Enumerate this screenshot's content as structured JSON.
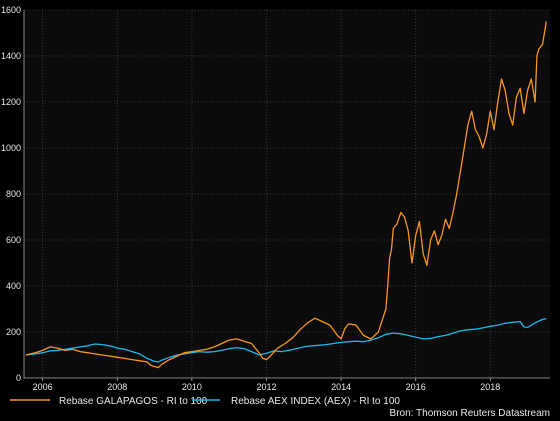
{
  "chart_data": {
    "type": "line",
    "title": "",
    "xlabel": "",
    "ylabel": "",
    "xlim": [
      2005.5,
      2019.6
    ],
    "ylim": [
      0,
      1600
    ],
    "x_ticks": [
      {
        "value": 2006,
        "label": "2006"
      },
      {
        "value": 2008,
        "label": "2008"
      },
      {
        "value": 2010,
        "label": "2010"
      },
      {
        "value": 2012,
        "label": "2012"
      },
      {
        "value": 2014,
        "label": "2014"
      },
      {
        "value": 2016,
        "label": "2016"
      },
      {
        "value": 2018,
        "label": "2018"
      }
    ],
    "y_ticks": [
      {
        "value": 0,
        "label": "0"
      },
      {
        "value": 200,
        "label": "200"
      },
      {
        "value": 400,
        "label": "400"
      },
      {
        "value": 600,
        "label": "600"
      },
      {
        "value": 800,
        "label": "800"
      },
      {
        "value": 1000,
        "label": "1000"
      },
      {
        "value": 1200,
        "label": "1200"
      },
      {
        "value": 1400,
        "label": "1400"
      },
      {
        "value": 1600,
        "label": "1600"
      }
    ],
    "grid": true,
    "legend_position": "bottom",
    "series": [
      {
        "name": "Rebase GALAPAGOS - RI to 100",
        "color": "#f7941d",
        "points": [
          [
            2005.55,
            100
          ],
          [
            2005.8,
            110
          ],
          [
            2006.0,
            120
          ],
          [
            2006.2,
            135
          ],
          [
            2006.4,
            130
          ],
          [
            2006.6,
            120
          ],
          [
            2006.8,
            125
          ],
          [
            2007.0,
            115
          ],
          [
            2007.2,
            110
          ],
          [
            2007.4,
            105
          ],
          [
            2007.6,
            100
          ],
          [
            2007.8,
            95
          ],
          [
            2008.0,
            90
          ],
          [
            2008.2,
            85
          ],
          [
            2008.4,
            80
          ],
          [
            2008.6,
            75
          ],
          [
            2008.8,
            70
          ],
          [
            2008.9,
            55
          ],
          [
            2009.0,
            50
          ],
          [
            2009.1,
            45
          ],
          [
            2009.2,
            60
          ],
          [
            2009.4,
            80
          ],
          [
            2009.6,
            95
          ],
          [
            2009.8,
            110
          ],
          [
            2010.0,
            115
          ],
          [
            2010.2,
            120
          ],
          [
            2010.4,
            125
          ],
          [
            2010.6,
            135
          ],
          [
            2010.8,
            150
          ],
          [
            2011.0,
            165
          ],
          [
            2011.2,
            170
          ],
          [
            2011.4,
            160
          ],
          [
            2011.6,
            150
          ],
          [
            2011.8,
            110
          ],
          [
            2011.9,
            85
          ],
          [
            2012.0,
            80
          ],
          [
            2012.1,
            95
          ],
          [
            2012.3,
            130
          ],
          [
            2012.5,
            150
          ],
          [
            2012.7,
            175
          ],
          [
            2012.9,
            210
          ],
          [
            2013.1,
            240
          ],
          [
            2013.3,
            260
          ],
          [
            2013.5,
            245
          ],
          [
            2013.7,
            230
          ],
          [
            2013.9,
            185
          ],
          [
            2014.0,
            170
          ],
          [
            2014.1,
            215
          ],
          [
            2014.2,
            235
          ],
          [
            2014.4,
            230
          ],
          [
            2014.6,
            185
          ],
          [
            2014.8,
            170
          ],
          [
            2015.0,
            200
          ],
          [
            2015.1,
            250
          ],
          [
            2015.2,
            300
          ],
          [
            2015.25,
            400
          ],
          [
            2015.3,
            520
          ],
          [
            2015.35,
            560
          ],
          [
            2015.4,
            650
          ],
          [
            2015.5,
            670
          ],
          [
            2015.6,
            720
          ],
          [
            2015.7,
            700
          ],
          [
            2015.8,
            640
          ],
          [
            2015.9,
            500
          ],
          [
            2016.0,
            620
          ],
          [
            2016.1,
            680
          ],
          [
            2016.2,
            540
          ],
          [
            2016.3,
            490
          ],
          [
            2016.4,
            600
          ],
          [
            2016.5,
            640
          ],
          [
            2016.6,
            580
          ],
          [
            2016.7,
            620
          ],
          [
            2016.8,
            690
          ],
          [
            2016.9,
            650
          ],
          [
            2017.0,
            720
          ],
          [
            2017.1,
            800
          ],
          [
            2017.2,
            900
          ],
          [
            2017.3,
            1000
          ],
          [
            2017.4,
            1100
          ],
          [
            2017.5,
            1160
          ],
          [
            2017.6,
            1080
          ],
          [
            2017.7,
            1050
          ],
          [
            2017.8,
            1000
          ],
          [
            2017.9,
            1060
          ],
          [
            2018.0,
            1160
          ],
          [
            2018.1,
            1080
          ],
          [
            2018.2,
            1200
          ],
          [
            2018.3,
            1300
          ],
          [
            2018.4,
            1250
          ],
          [
            2018.5,
            1150
          ],
          [
            2018.6,
            1100
          ],
          [
            2018.7,
            1220
          ],
          [
            2018.8,
            1260
          ],
          [
            2018.9,
            1150
          ],
          [
            2019.0,
            1250
          ],
          [
            2019.1,
            1300
          ],
          [
            2019.2,
            1200
          ],
          [
            2019.25,
            1400
          ],
          [
            2019.3,
            1430
          ],
          [
            2019.4,
            1450
          ],
          [
            2019.5,
            1550
          ]
        ]
      },
      {
        "name": "Rebase AEX INDEX (AEX) - RI to 100",
        "color": "#1ab7ea",
        "points": [
          [
            2005.55,
            100
          ],
          [
            2005.8,
            105
          ],
          [
            2006.0,
            110
          ],
          [
            2006.2,
            118
          ],
          [
            2006.4,
            120
          ],
          [
            2006.6,
            125
          ],
          [
            2006.8,
            130
          ],
          [
            2007.0,
            135
          ],
          [
            2007.2,
            140
          ],
          [
            2007.4,
            148
          ],
          [
            2007.6,
            145
          ],
          [
            2007.8,
            140
          ],
          [
            2008.0,
            130
          ],
          [
            2008.2,
            125
          ],
          [
            2008.4,
            115
          ],
          [
            2008.6,
            105
          ],
          [
            2008.8,
            85
          ],
          [
            2009.0,
            72
          ],
          [
            2009.1,
            70
          ],
          [
            2009.2,
            78
          ],
          [
            2009.4,
            90
          ],
          [
            2009.6,
            100
          ],
          [
            2009.8,
            105
          ],
          [
            2010.0,
            110
          ],
          [
            2010.2,
            115
          ],
          [
            2010.4,
            112
          ],
          [
            2010.6,
            115
          ],
          [
            2010.8,
            120
          ],
          [
            2011.0,
            128
          ],
          [
            2011.2,
            132
          ],
          [
            2011.4,
            128
          ],
          [
            2011.6,
            115
          ],
          [
            2011.8,
            100
          ],
          [
            2012.0,
            108
          ],
          [
            2012.2,
            118
          ],
          [
            2012.4,
            115
          ],
          [
            2012.6,
            120
          ],
          [
            2012.8,
            128
          ],
          [
            2013.0,
            135
          ],
          [
            2013.2,
            140
          ],
          [
            2013.4,
            142
          ],
          [
            2013.6,
            145
          ],
          [
            2013.8,
            150
          ],
          [
            2014.0,
            155
          ],
          [
            2014.2,
            158
          ],
          [
            2014.4,
            160
          ],
          [
            2014.6,
            158
          ],
          [
            2014.8,
            165
          ],
          [
            2015.0,
            175
          ],
          [
            2015.2,
            190
          ],
          [
            2015.4,
            195
          ],
          [
            2015.6,
            192
          ],
          [
            2015.8,
            185
          ],
          [
            2016.0,
            178
          ],
          [
            2016.2,
            170
          ],
          [
            2016.4,
            172
          ],
          [
            2016.6,
            180
          ],
          [
            2016.8,
            185
          ],
          [
            2017.0,
            195
          ],
          [
            2017.2,
            205
          ],
          [
            2017.4,
            210
          ],
          [
            2017.6,
            212
          ],
          [
            2017.8,
            218
          ],
          [
            2018.0,
            225
          ],
          [
            2018.2,
            230
          ],
          [
            2018.4,
            238
          ],
          [
            2018.6,
            242
          ],
          [
            2018.8,
            245
          ],
          [
            2018.9,
            222
          ],
          [
            2019.0,
            220
          ],
          [
            2019.2,
            240
          ],
          [
            2019.4,
            255
          ],
          [
            2019.5,
            258
          ]
        ]
      }
    ]
  },
  "source": "Bron: Thomson Reuters Datastream"
}
